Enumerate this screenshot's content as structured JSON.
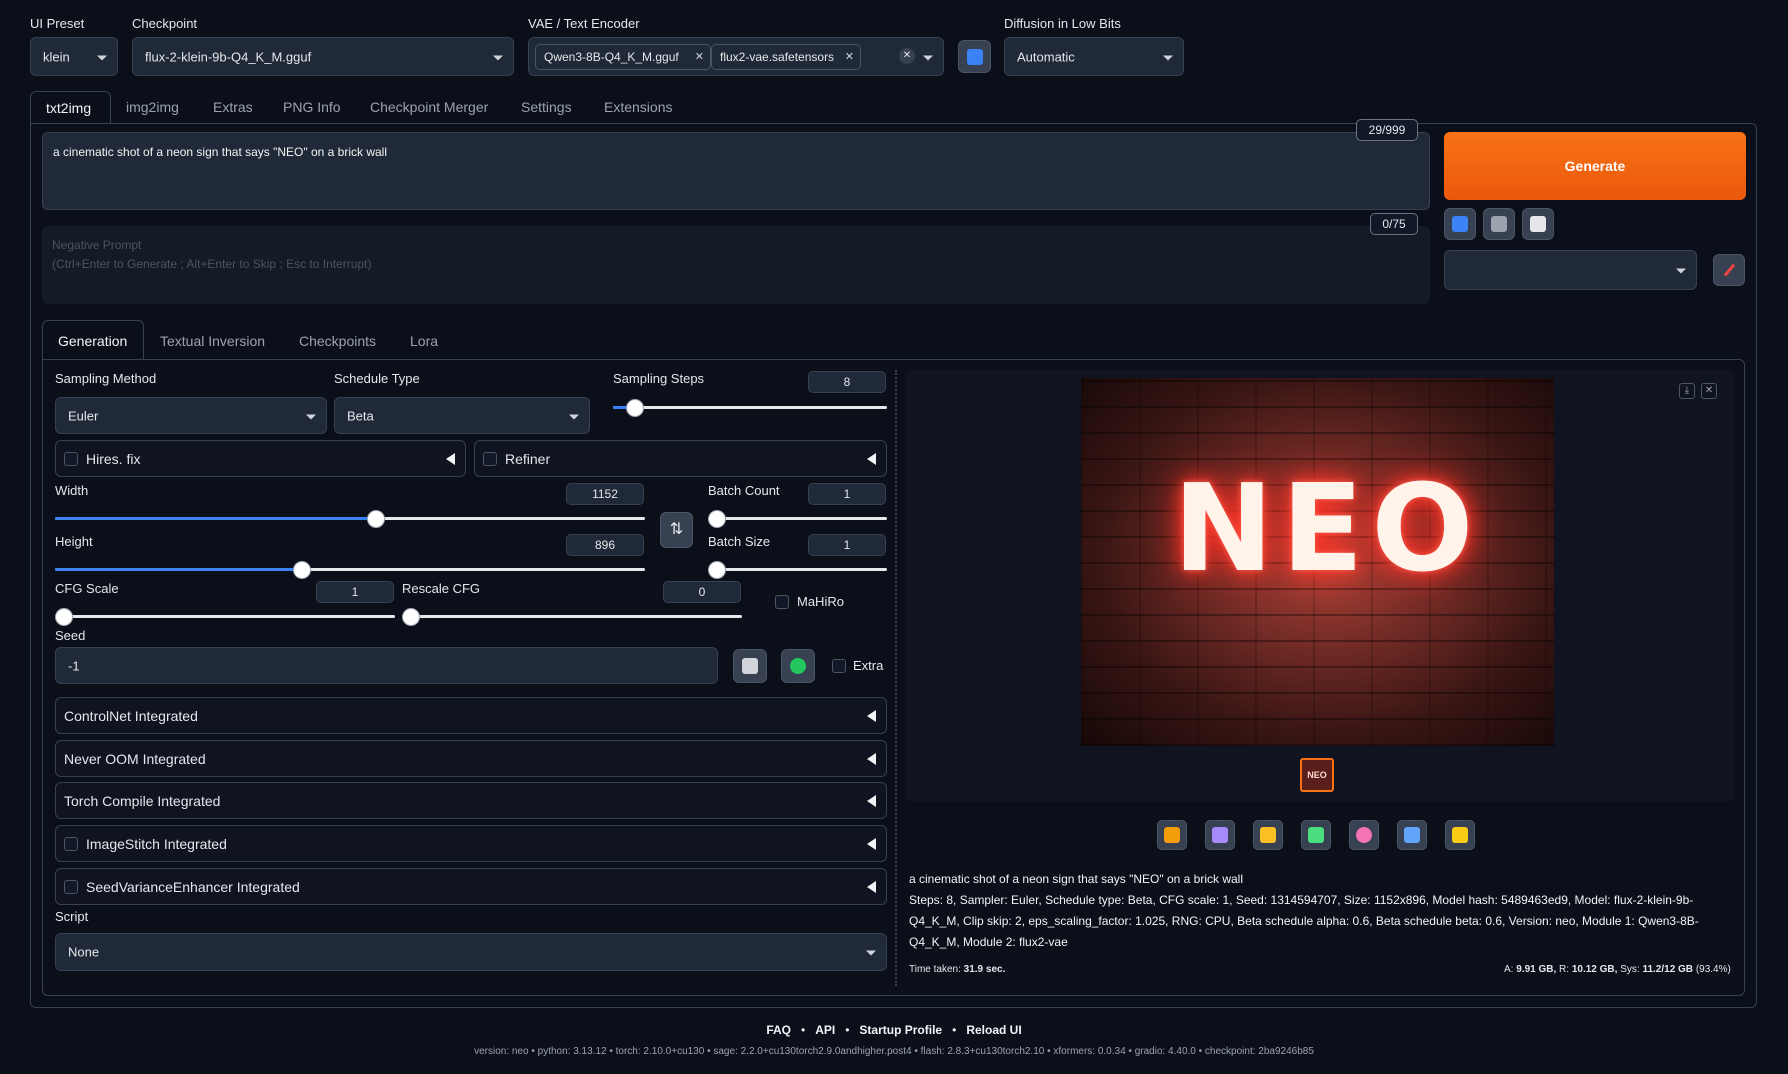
{
  "top": {
    "ui_preset": {
      "label": "UI Preset",
      "value": "klein"
    },
    "checkpoint": {
      "label": "Checkpoint",
      "value": "flux-2-klein-9b-Q4_K_M.gguf"
    },
    "vae": {
      "label": "VAE / Text Encoder",
      "tags": [
        "Qwen3-8B-Q4_K_M.gguf",
        "flux2-vae.safetensors"
      ]
    },
    "diffusion": {
      "label": "Diffusion in Low Bits",
      "value": "Automatic"
    }
  },
  "main_tabs": [
    "txt2img",
    "img2img",
    "Extras",
    "PNG Info",
    "Checkpoint Merger",
    "Settings",
    "Extensions"
  ],
  "prompt": {
    "value": "a cinematic shot of a neon sign that says \"NEO\" on a brick wall",
    "counter": "29/999",
    "neg_counter": "0/75",
    "neg_placeholder_1": "Negative Prompt",
    "neg_placeholder_2": "(Ctrl+Enter to Generate ; Alt+Enter to Skip ; Esc to Interrupt)"
  },
  "generate_label": "Generate",
  "sub_tabs": [
    "Generation",
    "Textual Inversion",
    "Checkpoints",
    "Lora"
  ],
  "gen": {
    "sampling_method": {
      "label": "Sampling Method",
      "value": "Euler"
    },
    "schedule_type": {
      "label": "Schedule Type",
      "value": "Beta"
    },
    "sampling_steps": {
      "label": "Sampling Steps",
      "value": "8"
    },
    "hires_fix": "Hires. fix",
    "refiner": "Refiner",
    "width": {
      "label": "Width",
      "value": "1152"
    },
    "height": {
      "label": "Height",
      "value": "896"
    },
    "batch_count": {
      "label": "Batch Count",
      "value": "1"
    },
    "batch_size": {
      "label": "Batch Size",
      "value": "1"
    },
    "cfg": {
      "label": "CFG Scale",
      "value": "1"
    },
    "rescale_cfg": {
      "label": "Rescale CFG",
      "value": "0"
    },
    "mahiro": "MaHiRo",
    "seed": {
      "label": "Seed",
      "value": "-1"
    },
    "extra": "Extra",
    "accordions": [
      "ControlNet Integrated",
      "Never OOM Integrated",
      "Torch Compile Integrated",
      "ImageStitch Integrated",
      "SeedVarianceEnhancer Integrated"
    ],
    "script": {
      "label": "Script",
      "value": "None"
    }
  },
  "image_text": "NEO",
  "output": {
    "prompt": "a cinematic shot of a neon sign that says \"NEO\" on a brick wall",
    "params_1": "Steps: 8, Sampler: Euler, Schedule type: Beta, CFG scale: 1, Seed: 1314594707, Size: 1152x896, Model hash: 5489463ed9, Model: flux-2-klein-9b-",
    "params_2": "Q4_K_M, Clip skip: 2, eps_scaling_factor: 1.025, RNG: CPU, Beta schedule alpha: 0.6, Beta schedule beta: 0.6, Version: neo, Module 1: Qwen3-8B-",
    "params_3": "Q4_K_M, Module 2: flux2-vae",
    "time_label": "Time taken:",
    "time_value": "31.9 sec.",
    "mem_a_label": "A:",
    "mem_a": "9.91 GB,",
    "mem_r_label": "R:",
    "mem_r": "10.12 GB,",
    "mem_sys_label": "Sys:",
    "mem_sys": "11.2/12 GB",
    "mem_pct": "(93.4%)"
  },
  "footer": {
    "links": [
      "FAQ",
      "API",
      "Startup Profile",
      "Reload UI"
    ],
    "version": "version: neo  •  python: 3.13.12  •  torch: 2.10.0+cu130  •  sage: 2.2.0+cu130torch2.9.0andhigher.post4  •  flash: 2.8.3+cu130torch2.10  •  xformers: 0.0.34  •  gradio: 4.40.0  •  checkpoint: 2ba9246b85"
  },
  "colors": {
    "accent": "#f97316",
    "bg": "#0b0f19",
    "slider_fill": "#3b82f6"
  }
}
